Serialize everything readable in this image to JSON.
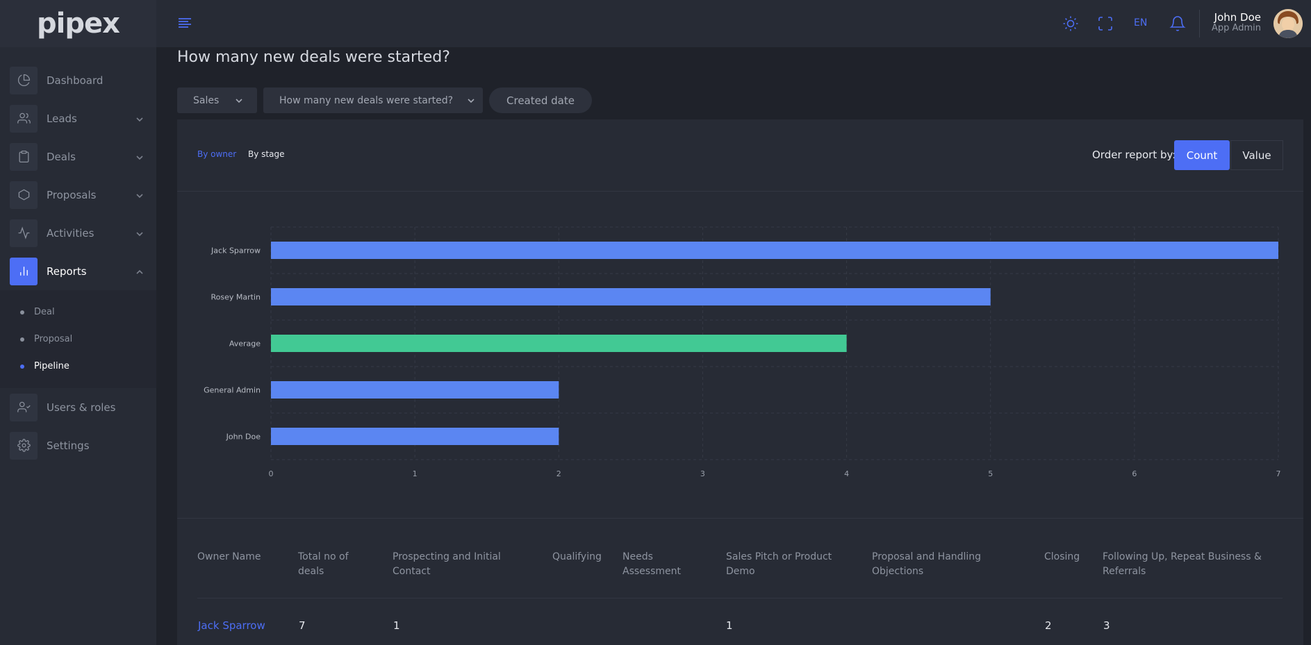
{
  "app": {
    "logo_text": "pipex"
  },
  "sidebar": {
    "items": [
      {
        "label": "Dashboard",
        "icon": "pie-chart-icon"
      },
      {
        "label": "Leads",
        "icon": "users-icon"
      },
      {
        "label": "Deals",
        "icon": "clipboard-icon"
      },
      {
        "label": "Proposals",
        "icon": "hexagon-icon"
      },
      {
        "label": "Activities",
        "icon": "activity-icon"
      },
      {
        "label": "Reports",
        "icon": "bar-chart-icon"
      },
      {
        "label": "Users & roles",
        "icon": "user-check-icon"
      },
      {
        "label": "Settings",
        "icon": "gear-icon"
      }
    ],
    "reports_sub": [
      {
        "label": "Deal"
      },
      {
        "label": "Proposal"
      },
      {
        "label": "Pipeline"
      }
    ]
  },
  "topbar": {
    "lang": "EN",
    "user_name": "John Doe",
    "user_role": "App Admin"
  },
  "page": {
    "title": "How many new deals were started?",
    "filters": {
      "pipeline": "Sales",
      "question": "How many new deals were started?",
      "date": "Created date"
    },
    "tabs": {
      "owner": "By owner",
      "stage": "By stage"
    },
    "order_label": "Order report by:",
    "order_count": "Count",
    "order_value": "Value"
  },
  "chart_data": {
    "type": "bar",
    "orientation": "horizontal",
    "categories": [
      "Jack Sparrow",
      "Rosey Martin",
      "Average",
      "General Admin",
      "John Doe"
    ],
    "values": [
      7,
      5,
      4,
      2,
      2
    ],
    "colors": [
      "#5b86f2",
      "#5b86f2",
      "#42c994",
      "#5b86f2",
      "#5b86f2"
    ],
    "xlim": [
      0,
      7
    ],
    "xticks": [
      "0",
      "1",
      "2",
      "3",
      "4",
      "5",
      "6",
      "7"
    ],
    "grid": true
  },
  "table": {
    "headers": [
      "Owner Name",
      "Total no of deals",
      "Prospecting and Initial Contact",
      "Qualifying",
      "Needs Assessment",
      "Sales Pitch or Product Demo",
      "Proposal and Handling Objections",
      "Closing",
      "Following Up, Repeat Business & Referrals"
    ],
    "rows": [
      {
        "owner": "Jack Sparrow",
        "total": "7",
        "prospecting": "1",
        "qualifying": "",
        "needs": "",
        "pitch": "1",
        "proposal": "",
        "closing": "2",
        "following": "3"
      }
    ]
  },
  "colors": {
    "accent": "#4d6ef5",
    "average": "#42c994",
    "bar": "#5b86f2"
  }
}
